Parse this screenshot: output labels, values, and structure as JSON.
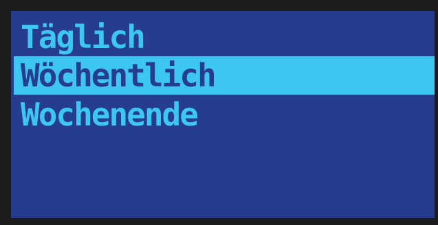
{
  "menu": {
    "items": [
      {
        "label": "Täglich",
        "selected": false
      },
      {
        "label": "Wöchentlich",
        "selected": true
      },
      {
        "label": "Wochenende",
        "selected": false
      }
    ]
  },
  "colors": {
    "frame": "#1c1c1c",
    "background": "#253d8c",
    "text": "#3ec6f2",
    "highlight": "#3ec6f2",
    "highlight_text": "#253d8c"
  }
}
